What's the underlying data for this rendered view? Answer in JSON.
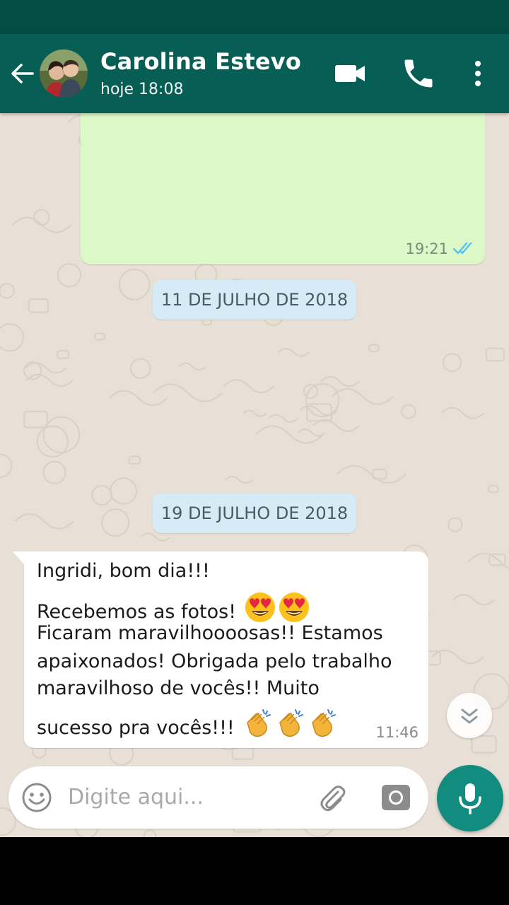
{
  "header": {
    "contact_name": "Carolina Estevo",
    "status": "hoje 18:08",
    "back_icon": "arrow-left-icon",
    "video_icon": "video-camera-icon",
    "call_icon": "phone-icon",
    "more_icon": "more-vertical-icon"
  },
  "messages": {
    "outgoing_top": {
      "time": "19:21",
      "status_icon": "double-check-icon"
    },
    "date_chip_1": "11 DE JULHO DE 2018",
    "date_chip_2": "19 DE JULHO DE 2018",
    "incoming": {
      "lines": [
        "Ingridi, bom dia!!!",
        "Recebemos as fotos!",
        "Ficaram maravilhoooosas!! Estamos",
        "apaixonados! Obrigada pelo trabalho",
        "maravilhoso de vocês!! Muito",
        "sucesso pra vocês!!!"
      ],
      "emoji_line2": "heart-eyes-emoji x2",
      "emoji_line6": "clapping-hands-emoji x3",
      "time": "11:46"
    }
  },
  "composer": {
    "placeholder": "Digite aqui...",
    "emoji_icon": "smiley-icon",
    "attach_icon": "paperclip-icon",
    "camera_icon": "camera-icon",
    "mic_icon": "microphone-icon"
  },
  "colors": {
    "header": "#075e54",
    "status_bar": "#054d44",
    "outgoing_bubble": "#dcf8c6",
    "date_chip": "#d5ebf5",
    "chat_background": "#e8e0d6",
    "mic_button": "#128c7e",
    "read_ticks": "#4fc3f7"
  }
}
